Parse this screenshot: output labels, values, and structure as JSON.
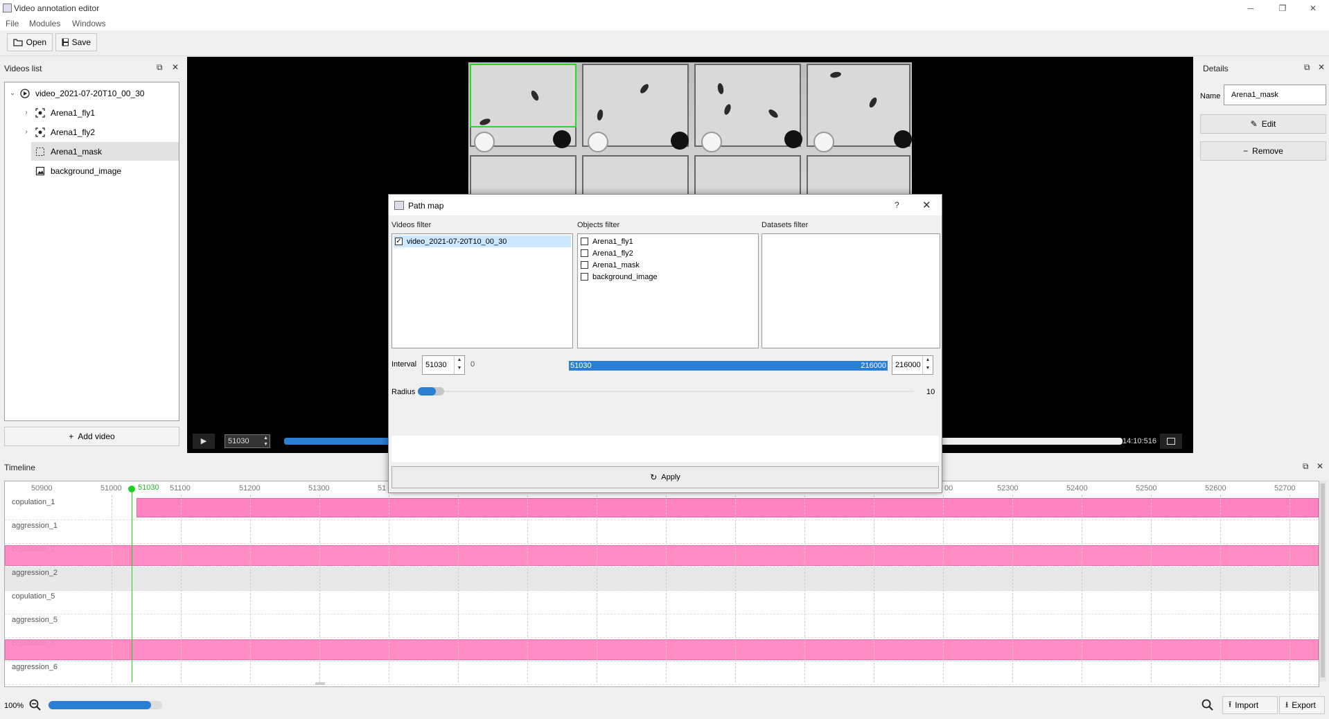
{
  "window": {
    "title": "Video annotation editor"
  },
  "menu": [
    "File",
    "Modules",
    "Windows"
  ],
  "toolbar": {
    "open_label": "Open",
    "save_label": "Save"
  },
  "videos_panel": {
    "title": "Videos list",
    "items": [
      "video_2021-07-20T10_00_30",
      "Arena1_fly1",
      "Arena1_fly2",
      "Arena1_mask",
      "background_image"
    ],
    "add_video_label": "Add video"
  },
  "player": {
    "frame_value": "51030",
    "time": "14:10:516"
  },
  "details": {
    "title": "Details",
    "name_label": "Name",
    "name_value": "Arena1_mask",
    "edit_label": "Edit",
    "remove_label": "Remove"
  },
  "timeline": {
    "title": "Timeline",
    "current_frame": "51030",
    "ticks_left": [
      "50900",
      "51000",
      "51100",
      "51200",
      "51300",
      "51"
    ],
    "ticks_right": [
      "00",
      "52300",
      "52400",
      "52500",
      "52600",
      "52700"
    ],
    "rows": [
      "copulation_1",
      "aggression_1",
      "copulation_2",
      "aggression_2",
      "copulation_5",
      "aggression_5",
      "copulation_6",
      "aggression_6"
    ]
  },
  "statusbar": {
    "zoom": "100%",
    "zoom_fill": 0.9,
    "import_label": "Import",
    "export_label": "Export"
  },
  "dialog": {
    "title": "Path map",
    "help": "?",
    "videos_filter_label": "Videos filter",
    "videos": [
      {
        "label": "video_2021-07-20T10_00_30",
        "checked": true
      }
    ],
    "objects_filter_label": "Objects filter",
    "objects": [
      {
        "label": "Arena1_fly1",
        "checked": false
      },
      {
        "label": "Arena1_fly2",
        "checked": false
      },
      {
        "label": "Arena1_mask",
        "checked": false
      },
      {
        "label": "background_image",
        "checked": false
      }
    ],
    "datasets_filter_label": "Datasets filter",
    "interval_label": "Interval",
    "interval_start": "51030",
    "interval_min": "0",
    "range_start": "51030",
    "range_end": "216000",
    "interval_end": "216000",
    "radius_label": "Radius",
    "radius_value": "10",
    "apply_label": "Apply"
  },
  "colors": {
    "accent": "#2b7fd3",
    "timeline_bar": "#ff83c1",
    "cursor": "#1fd11f",
    "selection_box": "#2bd62b"
  }
}
